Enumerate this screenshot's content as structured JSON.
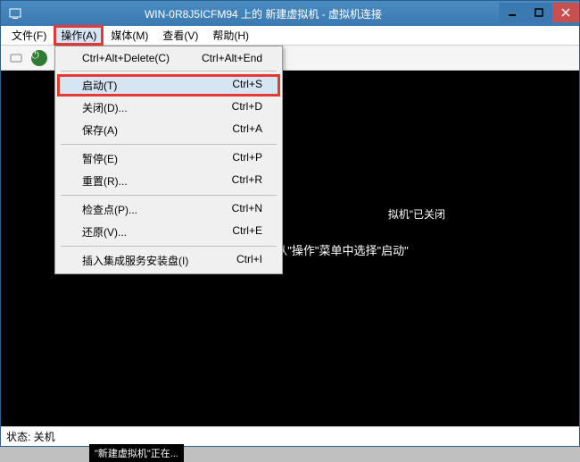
{
  "titlebar": {
    "title": "WIN-0R8J5ICFM94 上的 新建虚拟机 - 虚拟机连接"
  },
  "menubar": {
    "file": "文件(F)",
    "action": "操作(A)",
    "media": "媒体(M)",
    "view": "查看(V)",
    "help": "帮助(H)"
  },
  "dropdown": {
    "items": [
      {
        "label": "Ctrl+Alt+Delete(C)",
        "shortcut": "Ctrl+Alt+End",
        "highlighted": false
      },
      {
        "sep": true
      },
      {
        "label": "启动(T)",
        "shortcut": "Ctrl+S",
        "highlighted": true
      },
      {
        "label": "关闭(D)...",
        "shortcut": "Ctrl+D",
        "highlighted": false
      },
      {
        "label": "保存(A)",
        "shortcut": "Ctrl+A",
        "highlighted": false
      },
      {
        "sep": true
      },
      {
        "label": "暂停(E)",
        "shortcut": "Ctrl+P",
        "highlighted": false
      },
      {
        "label": "重置(R)...",
        "shortcut": "Ctrl+R",
        "highlighted": false
      },
      {
        "sep": true
      },
      {
        "label": "检查点(P)...",
        "shortcut": "Ctrl+N",
        "highlighted": false
      },
      {
        "label": "还原(V)...",
        "shortcut": "Ctrl+E",
        "highlighted": false
      },
      {
        "sep": true
      },
      {
        "label": "插入集成服务安装盘(I)",
        "shortcut": "Ctrl+I",
        "highlighted": false
      }
    ]
  },
  "content": {
    "main_partial": "拟机\"已关闭",
    "sub": "若要启动虚拟机，请从\"操作\"菜单中选择\"启动\""
  },
  "statusbar": {
    "text": "状态: 关机"
  },
  "taskbar_hint": "\"新建虚拟机\"正在..."
}
